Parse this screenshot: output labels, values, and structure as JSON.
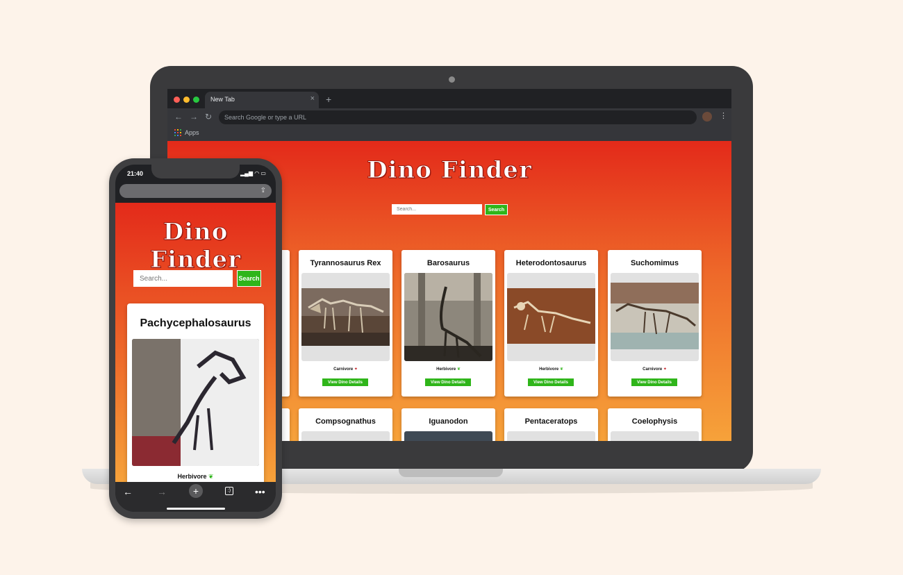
{
  "browser": {
    "tab_title": "New Tab",
    "omnibox_placeholder": "Search Google or type a URL",
    "bookmarks_apps_label": "Apps",
    "new_tab_symbol": "+",
    "close_symbol": "×"
  },
  "site": {
    "logo": "Dino Finder",
    "search_placeholder": "Search...",
    "search_button": "Search",
    "view_details_label": "View Dino Details"
  },
  "cards_row1": [
    {
      "name": "Tyrannosaurus Rex",
      "diet": "Carnivore"
    },
    {
      "name": "Barosaurus",
      "diet": "Herbivore"
    },
    {
      "name": "Heterodontosaurus",
      "diet": "Herbivore"
    },
    {
      "name": "Suchomimus",
      "diet": "Carnivore"
    }
  ],
  "cards_row2": [
    {
      "name": "Compsognathus"
    },
    {
      "name": "Iguanodon"
    },
    {
      "name": "Pentaceratops"
    },
    {
      "name": "Coelophysis"
    }
  ],
  "phone": {
    "time": "21:40",
    "status_icons": "▂▄▆ ◠ ▭",
    "card": {
      "name": "Pachycephalosaurus",
      "diet": "Herbivore"
    }
  },
  "colors": {
    "header_red": "#e32a1a",
    "footer_orange": "#f6a23a",
    "button_green": "#2fb51a"
  }
}
